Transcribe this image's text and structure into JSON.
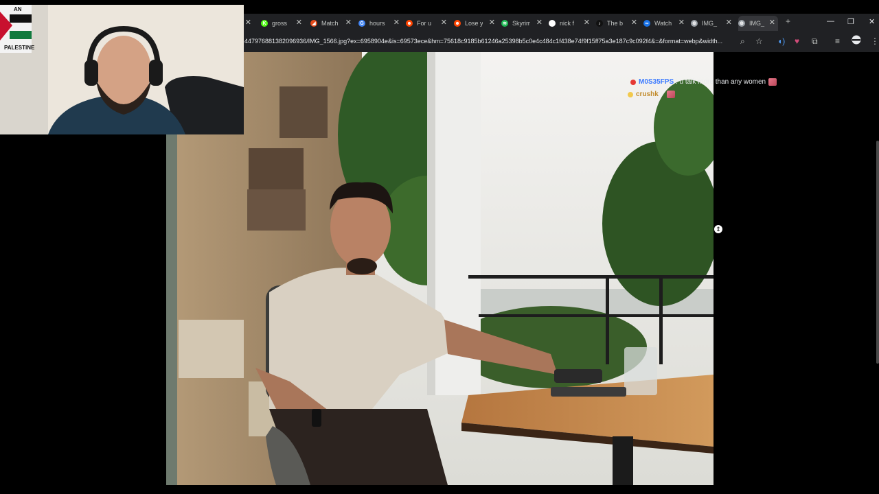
{
  "browser": {
    "tabs": [
      {
        "label": "gross",
        "favicon": "k-green",
        "color": "#53fc18",
        "glyph": "K"
      },
      {
        "label": "Match",
        "favicon": "flame",
        "color": "#e64a19",
        "glyph": "◢"
      },
      {
        "label": "hours",
        "favicon": "google-g",
        "color": "#4285f4",
        "glyph": "G"
      },
      {
        "label": "For u",
        "favicon": "reddit",
        "color": "#ff4500",
        "glyph": "☻"
      },
      {
        "label": "Lose y",
        "favicon": "reddit",
        "color": "#ff4500",
        "glyph": "☻"
      },
      {
        "label": "Skyrim",
        "favicon": "spotify",
        "color": "#1db954",
        "glyph": "≋"
      },
      {
        "label": "nick f",
        "favicon": "google-g",
        "color": "#ffffff",
        "glyph": "G"
      },
      {
        "label": "The b",
        "favicon": "tiktok",
        "color": "#111111",
        "glyph": "♪"
      },
      {
        "label": "Watch",
        "favicon": "globe-blue",
        "color": "#1a73e8",
        "glyph": "∞"
      },
      {
        "label": "IMG_",
        "favicon": "globe",
        "color": "#9aa0a6",
        "glyph": "⊕"
      },
      {
        "label": "IMG_",
        "favicon": "globe",
        "color": "#9aa0a6",
        "glyph": "⊕"
      }
    ],
    "new_tab": "+",
    "url": "447976881382096936/IMG_1566.jpg?ex=6958904e&is=69573ece&hm=75618c9185b61246a25398b5c0e4c484c1f438e74f9f15ff75a3e187c9c092f4&=&format=webp&width...",
    "window": {
      "minimize": "—",
      "restore": "❐",
      "close": "✕"
    }
  },
  "overlay": {
    "webcam_flag_text": "PALESTINE",
    "webcam_flag_top": "AN",
    "chat": [
      {
        "user": "M0S35FPS",
        "sep": " : ",
        "message": "u talk more than any women",
        "user_color": "#3d7bff",
        "badge_color": "#e53935",
        "emote": true
      },
      {
        "user": "crushk",
        "sep": " : ",
        "message": "",
        "user_color": "#c28b2c",
        "badge_color": "#f2c94c",
        "emote": true
      }
    ]
  }
}
